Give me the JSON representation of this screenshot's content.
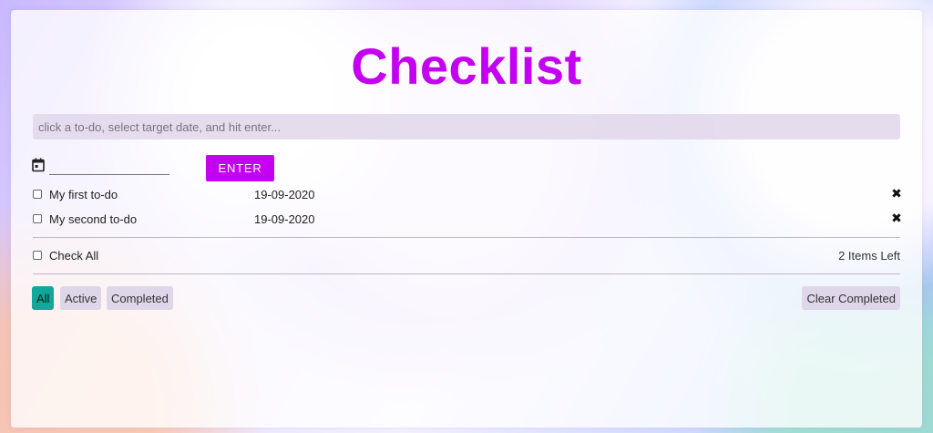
{
  "app": {
    "title": "Checklist"
  },
  "input": {
    "placeholder": "click a to-do, select target date, and hit enter..."
  },
  "date_input": {
    "value": ""
  },
  "enter_button": {
    "label": "ENTER"
  },
  "todos": [
    {
      "text": "My first to-do",
      "date": "19-09-2020",
      "checked": false,
      "delete_glyph": "✖"
    },
    {
      "text": "My second to-do",
      "date": "19-09-2020",
      "checked": false,
      "delete_glyph": "✖"
    }
  ],
  "footer": {
    "check_all_label": "Check All",
    "items_left": "2 Items Left"
  },
  "filters": [
    {
      "label": "All",
      "active": true
    },
    {
      "label": "Active",
      "active": false
    },
    {
      "label": "Completed",
      "active": false
    }
  ],
  "clear_completed": {
    "label": "Clear Completed"
  },
  "colors": {
    "accent": "#c400f0",
    "active_filter": "#0fa89a",
    "input_bg": "#e1d7eb"
  },
  "icons": {
    "date": "calendar-icon",
    "delete": "close-icon",
    "checkbox": "checkbox-icon"
  }
}
